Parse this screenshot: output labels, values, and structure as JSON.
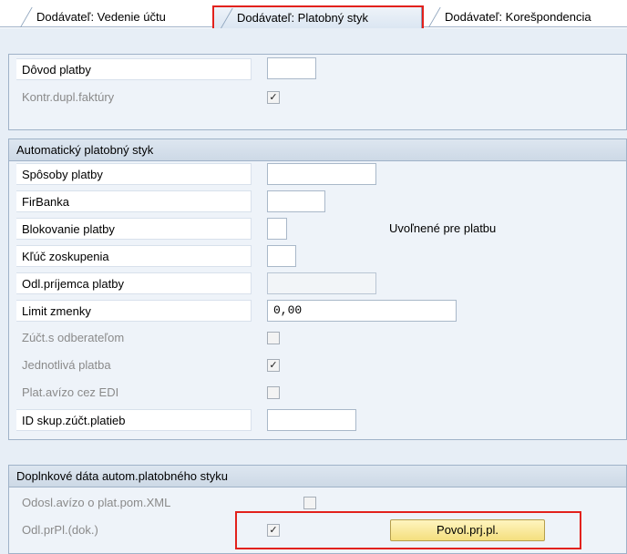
{
  "tabs": [
    {
      "label": "Dodávateľ: Vedenie účtu"
    },
    {
      "label": "Dodávateľ: Platobný styk"
    },
    {
      "label": "Dodávateľ: Korešpondencia"
    }
  ],
  "group1": {
    "rows": {
      "dovod_platby": {
        "label": "Dôvod platby"
      },
      "kontr_dupl": {
        "label": "Kontr.dupl.faktúry",
        "checked_mark": "✓"
      }
    }
  },
  "group2": {
    "title": "Automatický platobný styk",
    "rows": {
      "sposoby_platby": {
        "label": "Spôsoby platby"
      },
      "firbanka": {
        "label": "FirBanka"
      },
      "blokovanie": {
        "label": "Blokovanie platby",
        "status_text": "Uvoľnené pre platbu"
      },
      "kluc": {
        "label": "Kľúč zoskupenia"
      },
      "odl_prijemca": {
        "label": "Odl.príjemca platby"
      },
      "limit": {
        "label": "Limit zmenky",
        "value": "0,00"
      },
      "zuct": {
        "label": "Zúčt.s odberateľom",
        "checked_mark": ""
      },
      "jednotliva": {
        "label": "Jednotlivá platba",
        "checked_mark": "✓"
      },
      "plat_avizo": {
        "label": "Plat.avízo cez EDI",
        "checked_mark": ""
      },
      "id_skup": {
        "label": "ID skup.zúčt.platieb"
      }
    }
  },
  "group3": {
    "title": "Doplnkové dáta autom.platobného styku",
    "rows": {
      "odosl": {
        "label": "Odosl.avízo o plat.pom.XML",
        "checked_mark": ""
      },
      "odl_prpl": {
        "label": "Odl.prPl.(dok.)",
        "checked_mark": "✓",
        "button_label": "Povol.prj.pl."
      }
    }
  },
  "colors": {
    "highlight": "#e2211c",
    "panel_bg": "#e7eef6",
    "button_bg": "#f4df7e"
  }
}
